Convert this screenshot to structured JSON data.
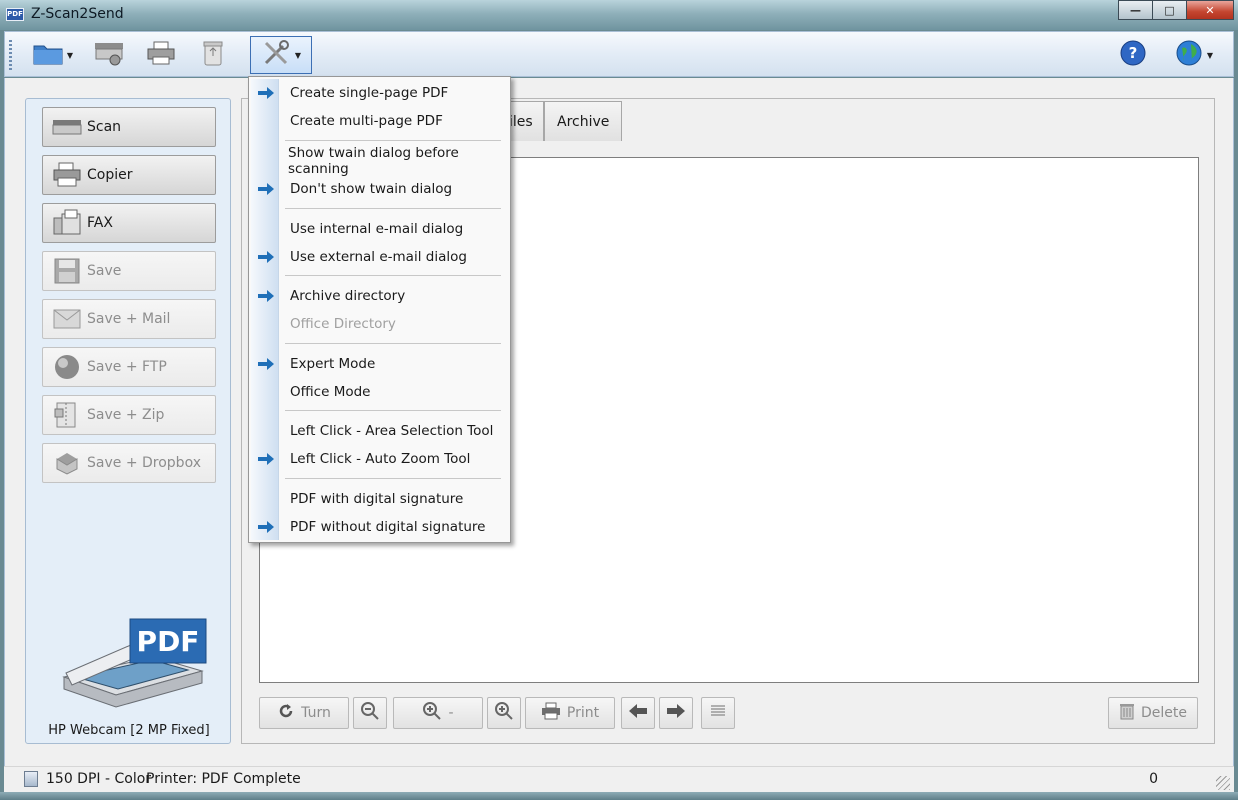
{
  "window": {
    "title": "Z-Scan2Send",
    "icon_text": "PDF"
  },
  "titlebar_buttons": {
    "minimize": "—",
    "maximize": "□",
    "close": "✕"
  },
  "toolbar": {
    "icons": [
      "folder-icon",
      "scanner-icon",
      "printer-icon",
      "recycle-icon",
      "tools-icon",
      "help-icon",
      "globe-icon"
    ]
  },
  "sidebar": {
    "buttons": [
      {
        "label": "Scan",
        "icon": "scanner-icon",
        "enabled": true
      },
      {
        "label": "Copier",
        "icon": "copier-icon",
        "enabled": true
      },
      {
        "label": "FAX",
        "icon": "fax-icon",
        "enabled": true
      },
      {
        "label": "Save",
        "icon": "floppy-icon",
        "enabled": false
      },
      {
        "label": "Save + Mail",
        "icon": "mail-icon",
        "enabled": false
      },
      {
        "label": "Save + FTP",
        "icon": "sphere-icon",
        "enabled": false
      },
      {
        "label": "Save + Zip",
        "icon": "zip-icon",
        "enabled": false
      },
      {
        "label": "Save + Dropbox",
        "icon": "dropbox-icon",
        "enabled": false
      }
    ],
    "device_badge": "PDF",
    "device_label": "HP Webcam [2 MP Fixed]"
  },
  "tabs": {
    "partial": "iles",
    "archive": "Archive"
  },
  "bottom_toolbar": {
    "turn": "Turn",
    "zoom_level": "-",
    "print": "Print",
    "delete": "Delete"
  },
  "status": {
    "resolution": "150 DPI - Color",
    "printer": "Printer: PDF Complete",
    "count": "0"
  },
  "menu": {
    "items": [
      {
        "label": "Create single-page PDF",
        "checked": true,
        "enabled": true
      },
      {
        "label": "Create multi-page PDF",
        "checked": false,
        "enabled": true
      },
      {
        "label": "Show twain dialog before scanning",
        "checked": false,
        "enabled": true
      },
      {
        "label": "Don't show twain dialog",
        "checked": true,
        "enabled": true
      },
      {
        "label": "Use internal e-mail dialog",
        "checked": false,
        "enabled": true
      },
      {
        "label": "Use external e-mail dialog",
        "checked": true,
        "enabled": true
      },
      {
        "label": "Archive directory",
        "checked": true,
        "enabled": true
      },
      {
        "label": "Office Directory",
        "checked": false,
        "enabled": false
      },
      {
        "label": "Expert Mode",
        "checked": true,
        "enabled": true
      },
      {
        "label": "Office Mode",
        "checked": false,
        "enabled": true
      },
      {
        "label": "Left Click - Area Selection Tool",
        "checked": false,
        "enabled": true
      },
      {
        "label": "Left Click - Auto Zoom Tool",
        "checked": true,
        "enabled": true
      },
      {
        "label": "PDF with digital signature",
        "checked": false,
        "enabled": true
      },
      {
        "label": "PDF without digital signature",
        "checked": true,
        "enabled": true
      }
    ]
  },
  "colors": {
    "menu_marker": "#1f6fb8",
    "pdf_badge": "#2b6bb3"
  }
}
